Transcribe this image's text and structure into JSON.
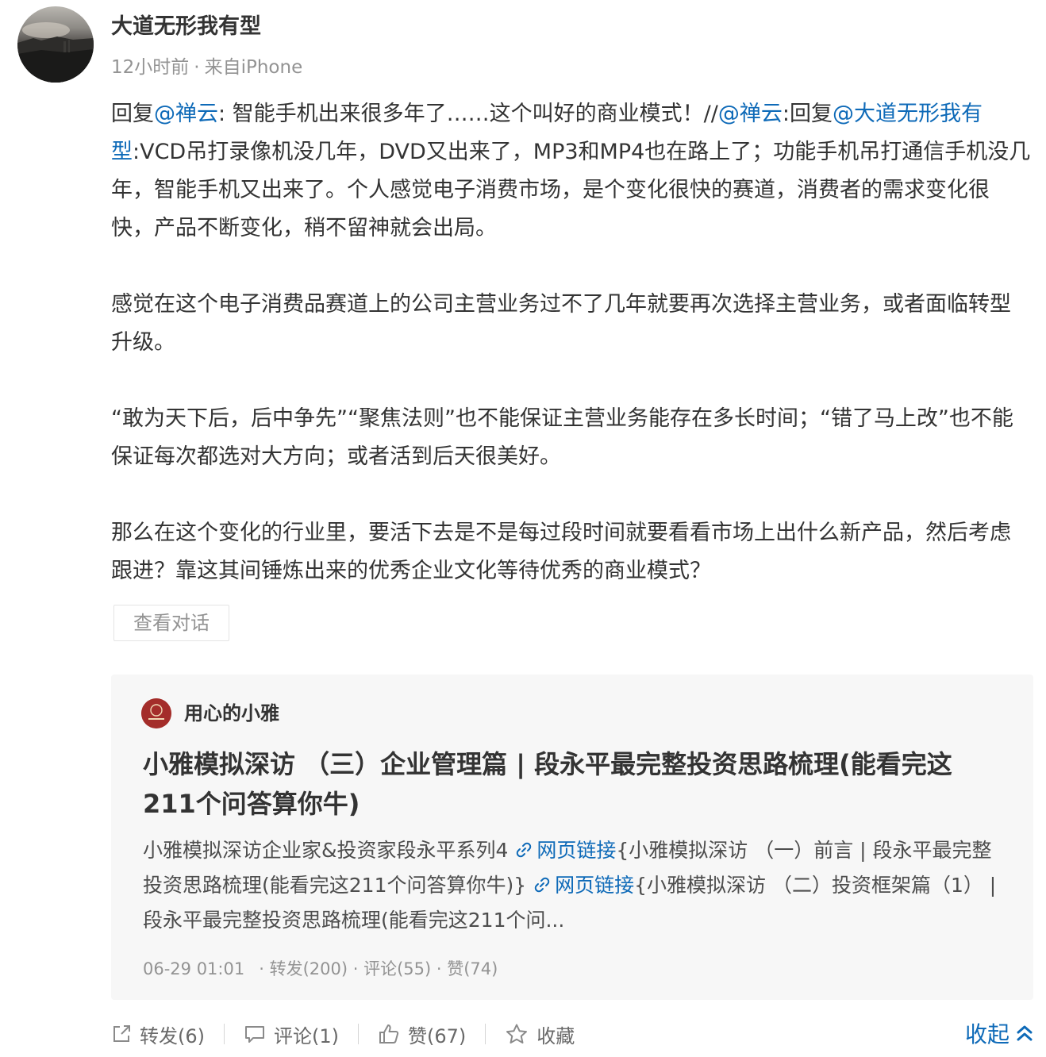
{
  "post": {
    "username": "大道无形我有型",
    "time": "12小时前",
    "source": "来自iPhone",
    "separator": "·",
    "content": {
      "p1": [
        {
          "text": "回复",
          "type": "text"
        },
        {
          "text": "@禅云",
          "type": "mention"
        },
        {
          "text": ": 智能手机出来很多年了……这个叫好的商业模式！//",
          "type": "text"
        },
        {
          "text": "@禅云",
          "type": "mention"
        },
        {
          "text": ":回复",
          "type": "text"
        },
        {
          "text": "@大道无形我有型",
          "type": "mention"
        },
        {
          "text": ":VCD吊打录像机没几年，DVD又出来了，MP3和MP4也在路上了；功能手机吊打通信手机没几年，智能手机又出来了。个人感觉电子消费市场，是个变化很快的赛道，消费者的需求变化很快，产品不断变化，稍不留神就会出局。",
          "type": "text"
        }
      ],
      "p2": "感觉在这个电子消费品赛道上的公司主营业务过不了几年就要再次选择主营业务，或者面临转型升级。",
      "p3": "“敢为天下后，后中争先”“聚焦法则”也不能保证主营业务能存在多长时间；“错了马上改”也不能保证每次都选对大方向；或者活到后天很美好。",
      "p4": "那么在这个变化的行业里，要活下去是不是每过段时间就要看看市场上出什么新产品，然后考虑跟进？靠这其间锤炼出来的优秀企业文化等待优秀的商业模式？"
    },
    "view_conversation_label": "查看对话"
  },
  "card": {
    "author": "用心的小雅",
    "avatar_icon": "xiaoya-logo-icon",
    "title": "小雅模拟深访 （三）企业管理篇 | 段永平最完整投资思路梳理(能看完这211个问答算你牛)",
    "summary_parts": {
      "s1": "小雅模拟深访企业家&投资家段永平系列4 ",
      "link1": "网页链接",
      "s2": "{小雅模拟深访 （一）前言 | 段永平最完整投资思路梳理(能看完这211个问答算你牛)} ",
      "link2": "网页链接",
      "s3": "{小雅模拟深访 （二）投资框架篇（1） | 段永平最完整投资思路梳理(能看完这211个问..."
    },
    "date": "06-29 01:01",
    "stats": "· 转发(200) · 评论(55) · 赞(74)"
  },
  "actions": {
    "repost": "转发(6)",
    "comment": "评论(1)",
    "like": "赞(67)",
    "favorite": "收藏",
    "collapse": "收起"
  },
  "colors": {
    "link": "#0e6ab8",
    "text": "#333333",
    "muted": "#939393",
    "card_bg": "#f7f7f7"
  }
}
